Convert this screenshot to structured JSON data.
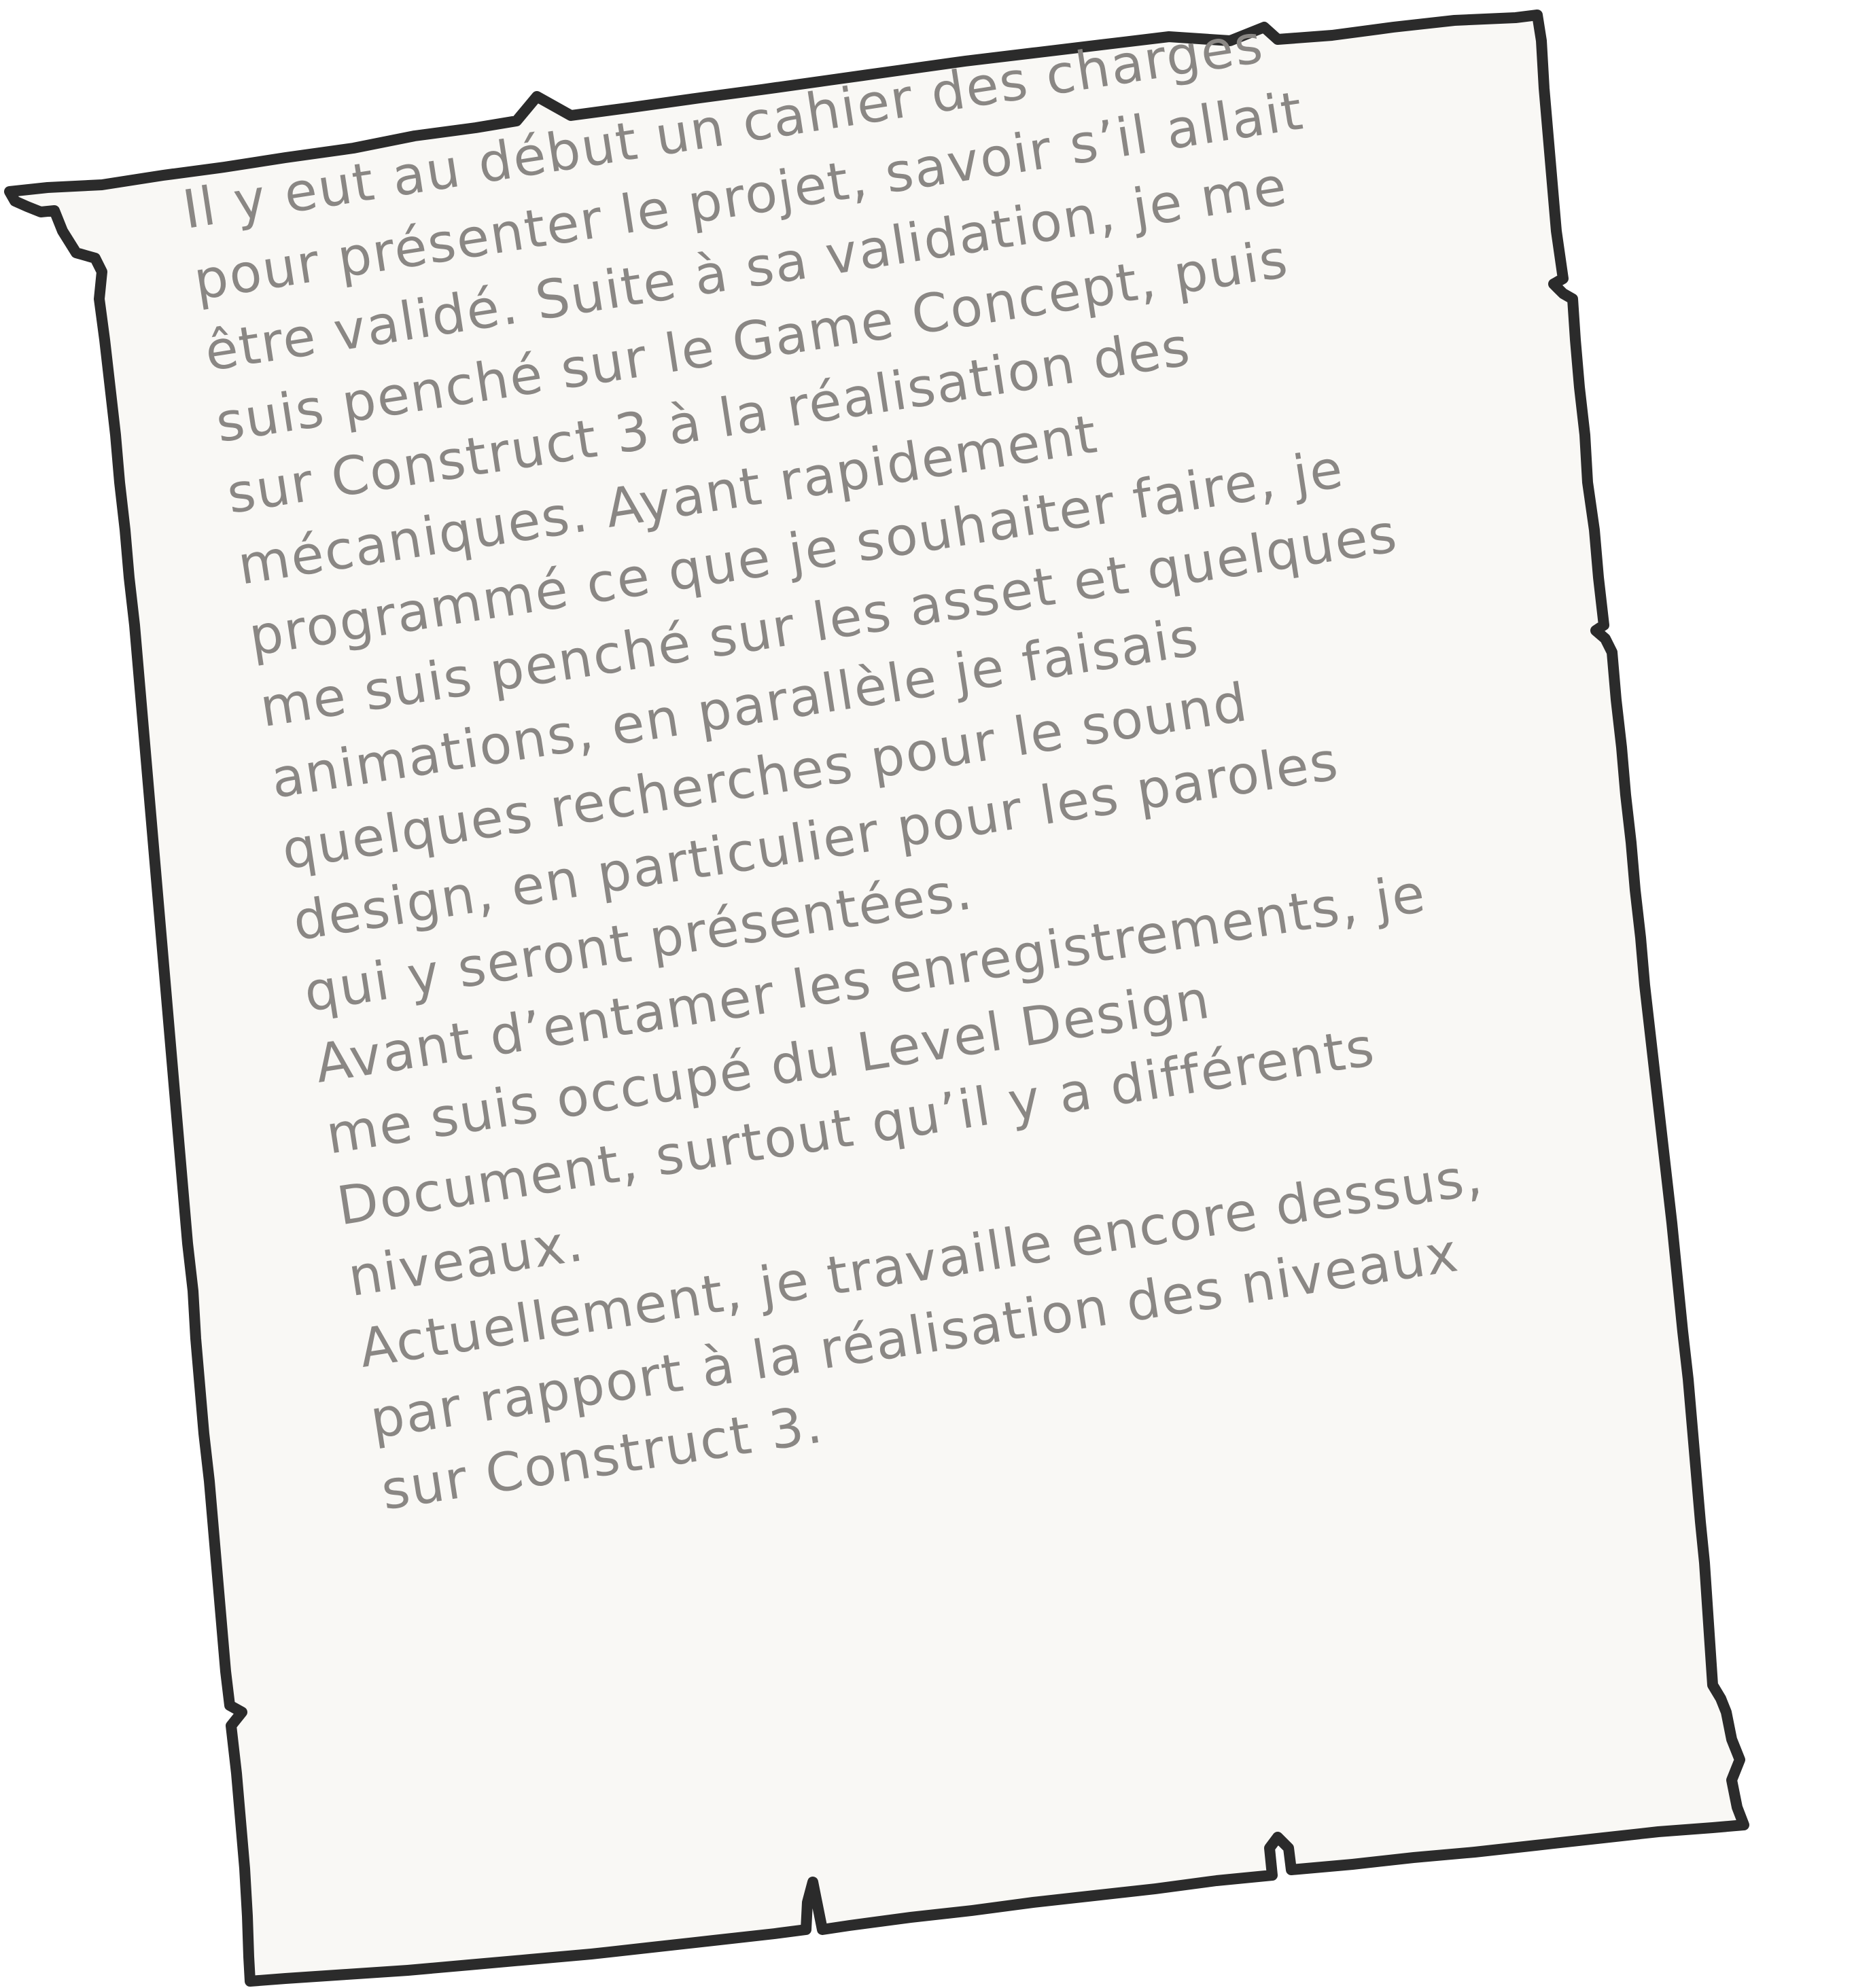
{
  "paper": {
    "fill_color": "#f9f8f5",
    "stroke_color": "#2b2b2b",
    "text_color": "#8a8784"
  },
  "text_lines": [
    "Il y eut au début un cahier des charges",
    "pour présenter le projet, savoir s’il allait",
    "être validé. Suite à sa validation, je me",
    "suis penché sur le Game Concept, puis",
    "sur Construct 3 à la réalisation des",
    "mécaniques. Ayant rapidement",
    "programmé ce que je souhaiter faire, je",
    "me suis penché sur les asset et quelques",
    "animations, en parallèle je faisais",
    "quelques recherches pour le sound",
    "design, en particulier pour les paroles",
    "qui y seront présentées.",
    "Avant d’entamer les enregistrements, je",
    "me suis occupé du Level Design",
    "Document, surtout qu’il y a différents",
    "niveaux.",
    "Actuellement, je travaille encore dessus,",
    "par rapport à la réalisation des niveaux",
    "sur Construct 3."
  ]
}
